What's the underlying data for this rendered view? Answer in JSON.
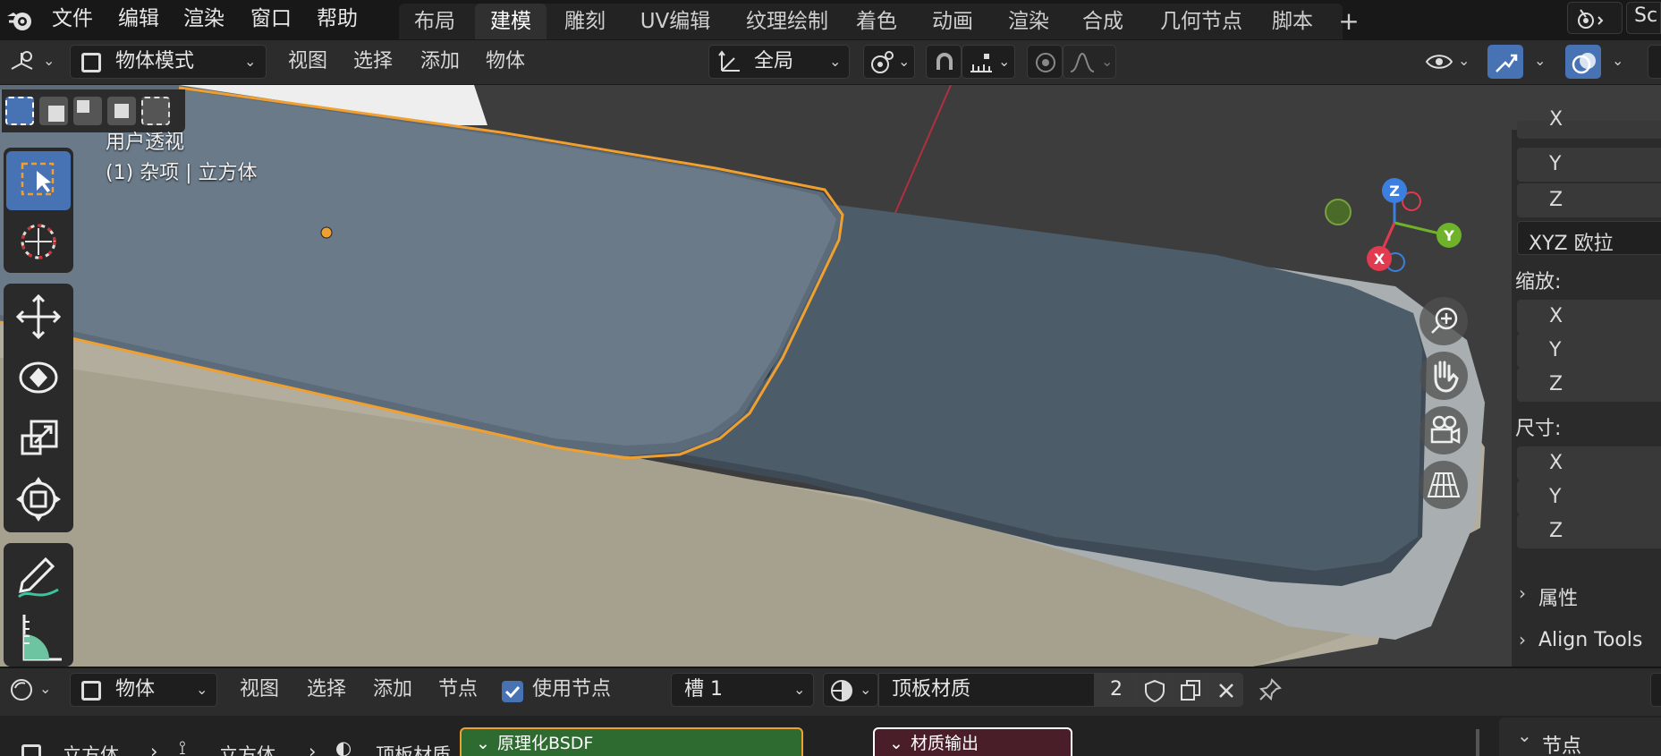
{
  "top_menu": {
    "items": [
      "文件",
      "编辑",
      "渲染",
      "窗口",
      "帮助"
    ]
  },
  "workspace_tabs": [
    "布局",
    "建模",
    "雕刻",
    "UV编辑",
    "纹理绘制",
    "着色",
    "动画",
    "渲染",
    "合成",
    "几何节点",
    "脚本"
  ],
  "active_workspace": "建模",
  "scene_label": "Sc",
  "viewport_header": {
    "mode": "物体模式",
    "menus": [
      "视图",
      "选择",
      "添加",
      "物体"
    ],
    "transform_orientation": "全局"
  },
  "viewport_overlay": {
    "view_name": "用户透视",
    "object_info": "(1) 杂项 | 立方体"
  },
  "gizmo": {
    "x": "X",
    "y": "Y",
    "z": "Z"
  },
  "n_panel": {
    "rotation_fields": [
      "X",
      "Y",
      "Z"
    ],
    "rotation_mode": "XYZ 欧拉",
    "scale_label": "缩放:",
    "scale_fields": [
      "X",
      "Y",
      "Z"
    ],
    "dimensions_label": "尺寸:",
    "dimension_fields": [
      "X",
      "Y",
      "Z"
    ],
    "properties_label": "属性",
    "align_tools_label": "Align Tools"
  },
  "node_header": {
    "context": "物体",
    "menus": [
      "视图",
      "选择",
      "添加",
      "节点"
    ],
    "use_nodes_label": "使用节点",
    "use_nodes_checked": true,
    "slot": "槽 1",
    "material_name": "顶板材质",
    "user_count": "2"
  },
  "node_breadcrumb": [
    "立方体",
    "立方体",
    "顶板材质"
  ],
  "nodes": {
    "bsdf": "原理化BSDF",
    "output": "材质输出"
  },
  "node_sidebar_label": "节点",
  "colors": {
    "accent_blue": "#4772b3",
    "selection_orange": "#f0a030",
    "axis_x": "#e23a4f",
    "axis_y": "#6fb32a",
    "axis_z": "#3b7fe0"
  }
}
